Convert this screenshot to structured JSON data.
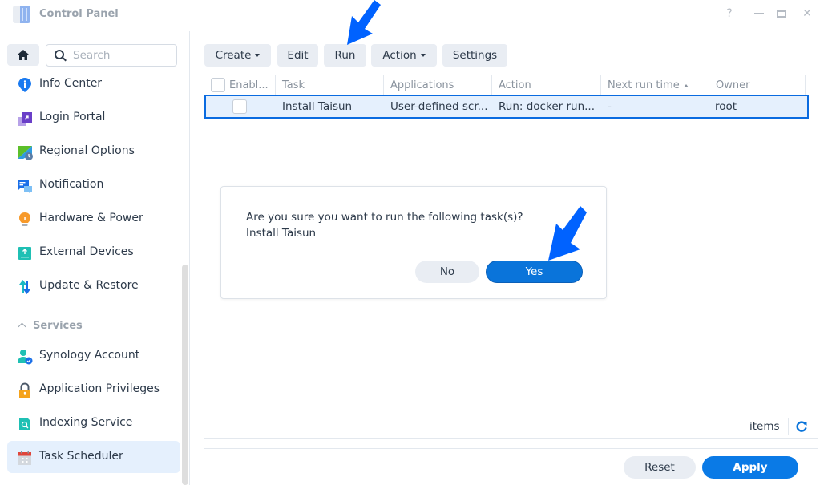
{
  "window": {
    "title": "Control Panel",
    "controls": {
      "help": "?",
      "minimize": "minimize",
      "maximize": "maximize",
      "close": "✕"
    }
  },
  "sidebar": {
    "search_placeholder": "Search",
    "items": [
      {
        "label": "Info Center",
        "icon": "info-center-icon"
      },
      {
        "label": "Login Portal",
        "icon": "login-portal-icon"
      },
      {
        "label": "Regional Options",
        "icon": "regional-options-icon"
      },
      {
        "label": "Notification",
        "icon": "notification-icon"
      },
      {
        "label": "Hardware & Power",
        "icon": "hardware-power-icon"
      },
      {
        "label": "External Devices",
        "icon": "external-devices-icon"
      },
      {
        "label": "Update & Restore",
        "icon": "update-restore-icon"
      }
    ],
    "section": {
      "label": "Services",
      "expanded": true
    },
    "service_items": [
      {
        "label": "Synology Account",
        "icon": "synology-account-icon"
      },
      {
        "label": "Application Privileges",
        "icon": "application-privileges-icon"
      },
      {
        "label": "Indexing Service",
        "icon": "indexing-service-icon"
      },
      {
        "label": "Task Scheduler",
        "icon": "task-scheduler-icon",
        "active": true
      }
    ]
  },
  "toolbar": {
    "create": "Create",
    "edit": "Edit",
    "run": "Run",
    "action": "Action",
    "settings": "Settings"
  },
  "grid": {
    "columns": [
      "Enabl...",
      "Task",
      "Applications",
      "Action",
      "Next run time",
      "Owner"
    ],
    "sort_column": "Next run time",
    "sort_direction": "ascending",
    "rows": [
      {
        "enabled": false,
        "task": "Install Taisun",
        "applications": "User-defined scr...",
        "action": "Run: docker run...",
        "next_run_time": "-",
        "owner": "root",
        "selected": true
      }
    ]
  },
  "dialog": {
    "message": "Are you sure you want to run the following task(s)?",
    "task_name": "Install Taisun",
    "no_label": "No",
    "yes_label": "Yes"
  },
  "footer": {
    "items_label": "items",
    "reset_label": "Reset",
    "apply_label": "Apply"
  },
  "colors": {
    "accent": "#0a7ae6",
    "selection_bg": "#e5f0fd",
    "selection_border": "#0a6be0",
    "annotation_arrow": "#0062ff"
  }
}
